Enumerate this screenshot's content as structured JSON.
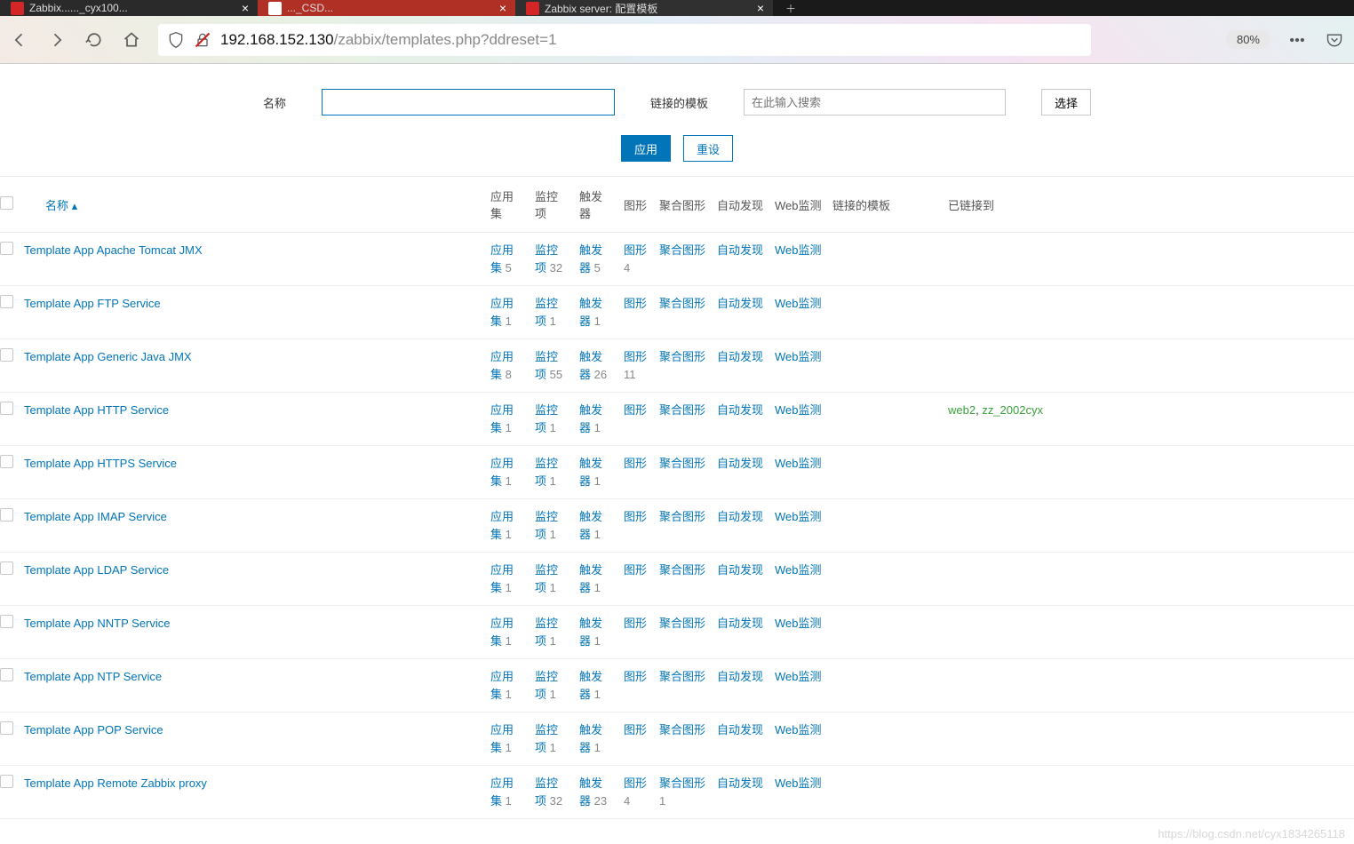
{
  "browser": {
    "tabs": [
      {
        "title": "Zabbix......_cyx100...",
        "favicon": "z"
      },
      {
        "title": "..._CSD...",
        "favicon": "c"
      },
      {
        "title": "Zabbix server: 配置模板",
        "favicon": "z"
      }
    ],
    "url_display": "192.168.152.130/zabbix/templates.php?ddreset=1",
    "url_host": "192.168.152.130",
    "url_path": "/zabbix/templates.php?ddreset=1",
    "zoom": "80%"
  },
  "filter": {
    "name_label": "名称",
    "name_value": "",
    "linked_label": "链接的模板",
    "search_placeholder": "在此输入搜索",
    "select_btn": "选择",
    "apply_btn": "应用",
    "reset_btn": "重设"
  },
  "columns": {
    "name": "名称 ▴",
    "apps": "应用集",
    "items": "监控项",
    "triggers": "触发器",
    "graphs": "图形",
    "screens": "聚合图形",
    "discovery": "自动发现",
    "web": "Web监测",
    "linked_tpl": "链接的模板",
    "linked_to": "已链接到"
  },
  "cell_labels": {
    "apps": "应用集",
    "items": "监控项",
    "triggers": "触发器",
    "graphs": "图形",
    "screens": "聚合图形",
    "discovery": "自动发现",
    "web": "Web监测"
  },
  "templates": [
    {
      "name": "Template App Apache Tomcat JMX",
      "apps": "5",
      "items": "32",
      "triggers": "5",
      "graphs": "4",
      "screens": "",
      "linked_to": ""
    },
    {
      "name": "Template App FTP Service",
      "apps": "1",
      "items": "1",
      "triggers": "1",
      "graphs": "",
      "screens": "",
      "linked_to": ""
    },
    {
      "name": "Template App Generic Java JMX",
      "apps": "8",
      "items": "55",
      "triggers": "26",
      "graphs": "11",
      "screens": "",
      "linked_to": ""
    },
    {
      "name": "Template App HTTP Service",
      "apps": "1",
      "items": "1",
      "triggers": "1",
      "graphs": "",
      "screens": "",
      "linked_to": "web2, zz_2002cyx"
    },
    {
      "name": "Template App HTTPS Service",
      "apps": "1",
      "items": "1",
      "triggers": "1",
      "graphs": "",
      "screens": "",
      "linked_to": ""
    },
    {
      "name": "Template App IMAP Service",
      "apps": "1",
      "items": "1",
      "triggers": "1",
      "graphs": "",
      "screens": "",
      "linked_to": ""
    },
    {
      "name": "Template App LDAP Service",
      "apps": "1",
      "items": "1",
      "triggers": "1",
      "graphs": "",
      "screens": "",
      "linked_to": ""
    },
    {
      "name": "Template App NNTP Service",
      "apps": "1",
      "items": "1",
      "triggers": "1",
      "graphs": "",
      "screens": "",
      "linked_to": ""
    },
    {
      "name": "Template App NTP Service",
      "apps": "1",
      "items": "1",
      "triggers": "1",
      "graphs": "",
      "screens": "",
      "linked_to": ""
    },
    {
      "name": "Template App POP Service",
      "apps": "1",
      "items": "1",
      "triggers": "1",
      "graphs": "",
      "screens": "",
      "linked_to": ""
    },
    {
      "name": "Template App Remote Zabbix proxy",
      "apps": "1",
      "items": "32",
      "triggers": "23",
      "graphs": "4",
      "screens": "1",
      "linked_to": ""
    }
  ],
  "watermark": "https://blog.csdn.net/cyx1834265118"
}
